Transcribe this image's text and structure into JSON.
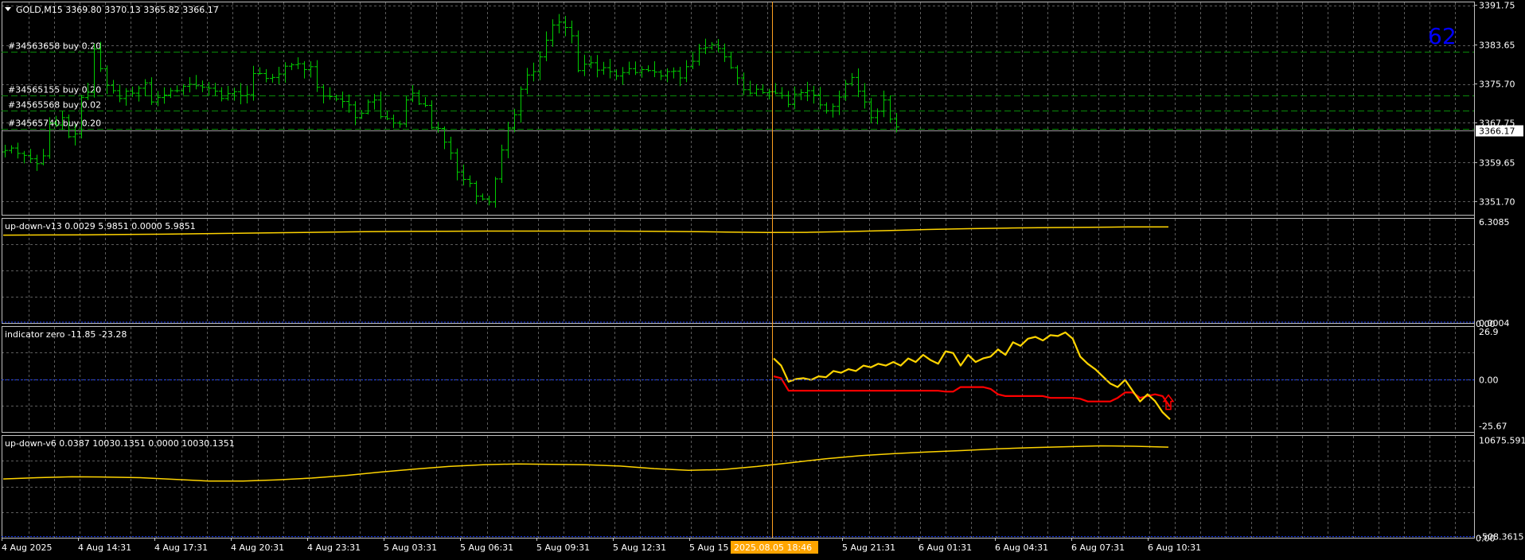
{
  "theme": {
    "background": "#000000",
    "grid": "#5c5c5c",
    "border": "#c0c0c0",
    "text": "#ffffff",
    "candle": "#00cc00",
    "order_line": "#0a8a0a",
    "yellow": "#ffd400",
    "red": "#ff0000",
    "blue_dotted": "#1a3cff",
    "crosshair": "#ffa020",
    "corner_number_color": "#0000ff",
    "time_badge_bg": "#ffa500"
  },
  "header": {
    "title": "GOLD,M15  3369.80 3370.13 3365.82 3366.17",
    "collapse_icon": "triangle-down-icon"
  },
  "corner_number": "62",
  "current_price_label": "3366.17",
  "crosshair_time_label": "2025.08.05 18:46",
  "chart_data": [
    {
      "type": "candlestick",
      "symbol": "GOLD",
      "timeframe": "M15",
      "ohlc_header": {
        "open": 3369.8,
        "high": 3370.13,
        "low": 3365.82,
        "close": 3366.17
      },
      "ylim": [
        3349.0,
        3392.5
      ],
      "y_ticks": [
        "3391.75",
        "3383.65",
        "3375.70",
        "3367.75",
        "3359.65",
        "3351.70"
      ],
      "y_tick_values": [
        3391.75,
        3383.65,
        3375.7,
        3367.75,
        3359.65,
        3351.7
      ],
      "current_price": 3366.17,
      "orders": [
        {
          "label": "#34563658 buy 0.20",
          "price": 3382.3
        },
        {
          "label": "#34565155 buy 0.20",
          "price": 3373.3
        },
        {
          "label": "#34565568 buy 0.02",
          "price": 3370.2
        },
        {
          "label": "#34565740 buy 0.20",
          "price": 3366.6
        }
      ],
      "close_path": [
        3362.2,
        3362.7,
        3361.6,
        3361.2,
        3360.5,
        3359.5,
        3361.1,
        3367.8,
        3367.4,
        3368.9,
        3365.0,
        3365.6,
        3373.0,
        3374.1,
        3382.9,
        3378.9,
        3375.5,
        3374.4,
        3372.8,
        3374.3,
        3373.9,
        3374.9,
        3376.0,
        3372.1,
        3373.0,
        3373.5,
        3374.4,
        3374.4,
        3375.3,
        3375.7,
        3375.4,
        3375.1,
        3374.9,
        3374.3,
        3372.8,
        3373.8,
        3374.2,
        3373.4,
        3373.6,
        3377.9,
        3377.9,
        3376.9,
        3377.1,
        3377.8,
        3379.4,
        3379.7,
        3379.9,
        3378.7,
        3379.3,
        3375.1,
        3373.3,
        3373.2,
        3372.7,
        3372.2,
        3371.5,
        3368.9,
        3369.8,
        3372.1,
        3372.5,
        3369.1,
        3368.7,
        3367.8,
        3367.6,
        3372.5,
        3373.9,
        3371.7,
        3371.4,
        3366.9,
        3366.7,
        3363.9,
        3361.7,
        3357.8,
        3356.3,
        3355.5,
        3352.9,
        3352.3,
        3351.7,
        3356.4,
        3362.3,
        3366.8,
        3369.5,
        3374.7,
        3377.6,
        3378.3,
        3381.3,
        3384.7,
        3387.8,
        3388.4,
        3387.3,
        3385.6,
        3378.5,
        3379.8,
        3380.1,
        3378.6,
        3379.1,
        3378.3,
        3377.4,
        3378.1,
        3378.9,
        3378.1,
        3378.7,
        3378.5,
        3378.2,
        3377.4,
        3378.3,
        3378.4,
        3377.0,
        3379.3,
        3380.4,
        3383.0,
        3383.2,
        3383.8,
        3383.0,
        3381.3,
        3379.1,
        3377.0,
        3374.6,
        3373.9,
        3374.7,
        3374.0,
        3374.2,
        3373.9,
        3373.4,
        3371.6,
        3373.7,
        3374.0,
        3374.4,
        3373.5,
        3371.5,
        3370.3,
        3371.2,
        3373.1,
        3375.8,
        3377.1,
        3374.3,
        3372.1,
        3368.9,
        3370.2,
        3372.5,
        3368.6,
        3367.0
      ],
      "x_ticks": [
        "4 Aug 2025",
        "4 Aug 14:31",
        "4 Aug 17:31",
        "4 Aug 20:31",
        "4 Aug 23:31",
        "5 Aug 03:31",
        "5 Aug 06:31",
        "5 Aug 09:31",
        "5 Aug 12:31",
        "5 Aug 15",
        "5 Aug 21:31",
        "6 Aug 01:31",
        "6 Aug 04:31",
        "6 Aug 07:31",
        "6 Aug 10:31"
      ]
    },
    {
      "type": "line",
      "name": "up-down-v13",
      "header": "up-down-v13 0.0029 5.9851 0.0000 5.9851",
      "ylim": [
        0.0,
        6.55
      ],
      "y_ticks": [
        "6.3085",
        "0.0004"
      ],
      "y_tick_values": [
        6.3085,
        0.0004
      ],
      "bottom_extra_label": "0.00",
      "series": [
        {
          "name": "up-down-v13",
          "values": [
            5.48,
            5.49,
            5.5,
            5.52,
            5.54,
            5.57,
            5.6,
            5.63,
            5.66,
            5.69,
            5.71,
            5.72,
            5.73,
            5.73,
            5.73,
            5.73,
            5.72,
            5.7,
            5.67,
            5.64,
            5.65,
            5.7,
            5.76,
            5.83,
            5.88,
            5.92,
            5.95,
            5.97,
            5.99,
            5.99
          ]
        }
      ]
    },
    {
      "type": "line",
      "name": "indicator zero",
      "header": "indicator zero -11.85 -23.28",
      "ylim": [
        -29.0,
        30.0
      ],
      "y_ticks": [
        "26.9",
        "0.00",
        "-25.67"
      ],
      "y_tick_values": [
        26.9,
        0.0,
        -25.67
      ],
      "zero_line": 0.0,
      "series": [
        {
          "name": "yellow",
          "values": [
            12.0,
            8.0,
            -1.0,
            0.5,
            1.0,
            0.0,
            2.0,
            1.5,
            5.0,
            4.0,
            6.0,
            5.0,
            8.0,
            7.0,
            9.0,
            8.0,
            10.0,
            8.0,
            12.0,
            10.0,
            14.0,
            11.0,
            9.0,
            16.0,
            15.0,
            8.0,
            14.0,
            10.0,
            12.0,
            13.0,
            17.0,
            14.0,
            21.0,
            19.0,
            23.0,
            24.0,
            22.0,
            25.0,
            24.5,
            26.5,
            23.0,
            13.0,
            9.0,
            6.0,
            2.0,
            -2.0,
            -4.0,
            0.0,
            -6.0,
            -12.0,
            -8.0,
            -11.8,
            -18.0,
            -22.0
          ]
        },
        {
          "name": "red",
          "values": [
            2.0,
            1.0,
            -6.0,
            -6.0,
            -6.0,
            -6.0,
            -6.0,
            -6.0,
            -6.0,
            -6.0,
            -6.0,
            -6.0,
            -6.0,
            -6.0,
            -6.0,
            -6.0,
            -6.0,
            -6.0,
            -6.0,
            -6.0,
            -6.0,
            -6.0,
            -6.0,
            -6.5,
            -6.5,
            -4.0,
            -4.0,
            -4.0,
            -4.0,
            -5.0,
            -8.0,
            -9.0,
            -9.0,
            -9.0,
            -9.0,
            -9.0,
            -9.0,
            -10.0,
            -10.0,
            -10.0,
            -10.0,
            -10.5,
            -12.0,
            -12.0,
            -12.0,
            -12.0,
            -10.0,
            -7.0,
            -7.0,
            -10.0,
            -9.0,
            -8.0,
            -9.0,
            -15.0
          ]
        }
      ],
      "arrow_icon": "up-arrow-icon"
    },
    {
      "type": "line",
      "name": "up-down-v6",
      "header": "up-down-v6 0.0387 10030.1351 0.0000 10030.1351",
      "ylim": [
        -640.0,
        11300.0
      ],
      "y_ticks": [
        "10675.591",
        "-508.3615"
      ],
      "y_tick_values": [
        10675.591,
        -508.3615
      ],
      "bottom_extra_label": "0.00",
      "series": [
        {
          "name": "up-down-v6",
          "values": [
            6200,
            6350,
            6450,
            6420,
            6350,
            6150,
            5950,
            5950,
            6100,
            6300,
            6600,
            7000,
            7350,
            7650,
            7850,
            7950,
            7900,
            7850,
            7700,
            7400,
            7200,
            7300,
            7650,
            8100,
            8550,
            8900,
            9150,
            9350,
            9500,
            9700,
            9850,
            9950,
            10050,
            10000,
            9900
          ]
        }
      ]
    }
  ]
}
